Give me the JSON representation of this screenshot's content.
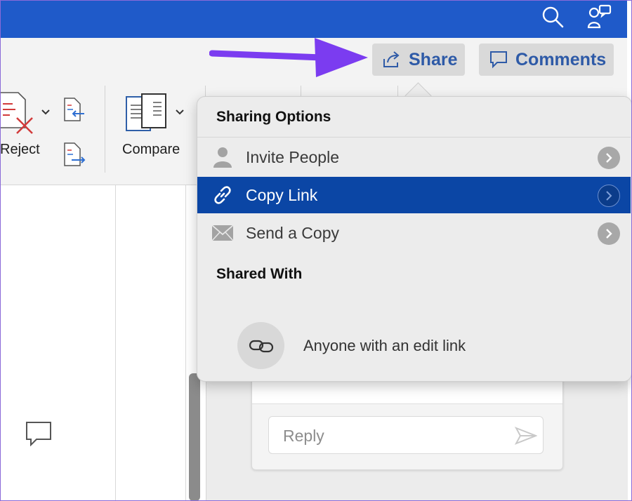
{
  "header": {
    "share_label": "Share",
    "comments_label": "Comments"
  },
  "ribbon": {
    "reject_label": "Reject",
    "compare_label": "Compare"
  },
  "sharing_menu": {
    "heading": "Sharing Options",
    "items": [
      {
        "label": "Invite People",
        "icon": "person-icon",
        "selected": false
      },
      {
        "label": "Copy Link",
        "icon": "link-icon",
        "selected": true
      },
      {
        "label": "Send a Copy",
        "icon": "envelope-icon",
        "selected": false
      }
    ],
    "shared_with_heading": "Shared With",
    "shared_with_entry": "Anyone with an edit link"
  },
  "comment_pane": {
    "reply_placeholder": "Reply"
  },
  "colors": {
    "titlebar": "#1f5ac9",
    "selected_row": "#0b46a5",
    "accent_text": "#2e5aa7",
    "annotation_arrow": "#7b3cf0"
  }
}
